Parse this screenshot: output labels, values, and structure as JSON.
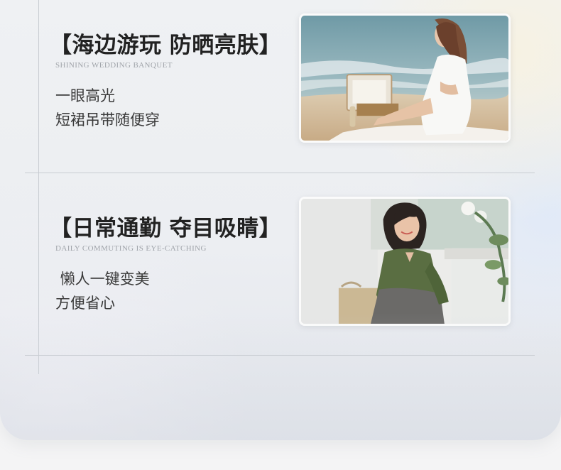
{
  "sections": [
    {
      "title": "【海边游玩 防晒亮肤】",
      "subtitle": "SHINING WEDDING BANQUET",
      "lines": [
        "一眼高光",
        "短裙吊带随便穿"
      ],
      "photo": "beach-photo"
    },
    {
      "title": "【日常通勤 夺目吸睛】",
      "subtitle": "DAILY COMMUTING IS EYE-CATCHING",
      "lines": [
        " 懒人一键变美",
        "方便省心"
      ],
      "photo": "commute-photo"
    }
  ],
  "colors": {
    "title": "#222222",
    "subtitle": "#a0a4aa",
    "body": "#3a3a3a",
    "divider": "#c8ccd2"
  }
}
